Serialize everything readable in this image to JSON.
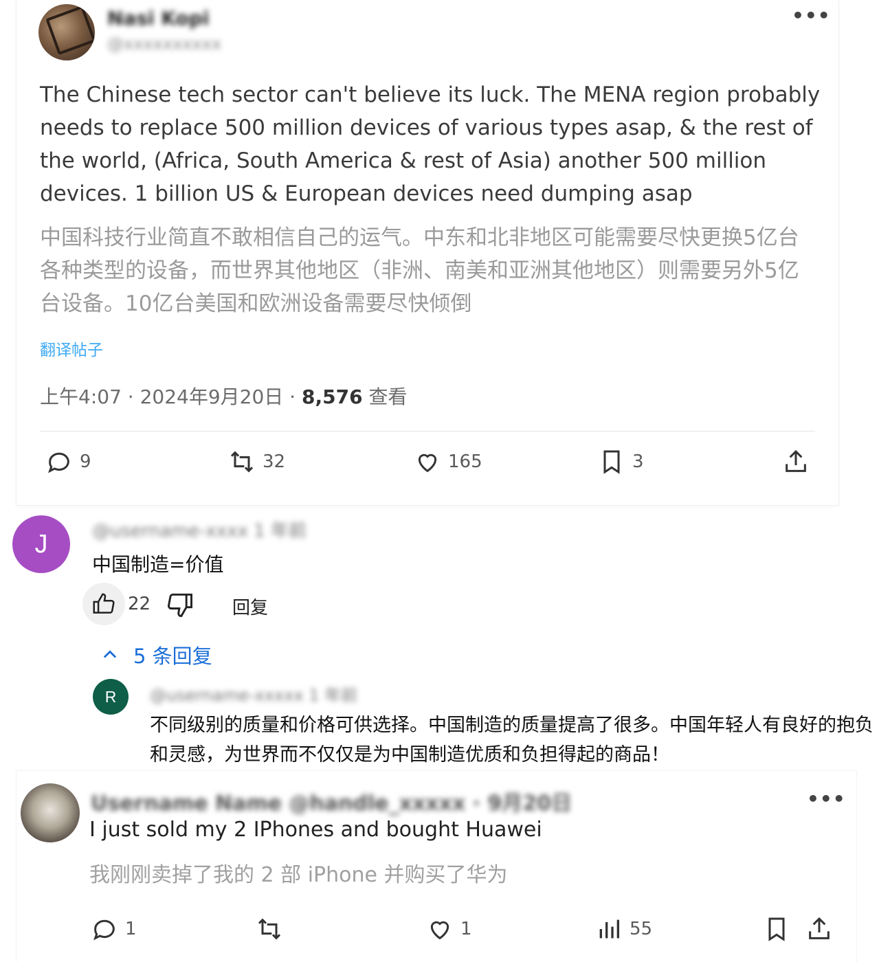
{
  "tweet": {
    "author_name": "Nasi Kopi",
    "author_handle": "@xxxxxxxxxx",
    "more": "•••",
    "text": "The Chinese tech sector can't believe its luck. The MENA region probably needs to replace 500 million devices of various types asap, & the rest of the world, (Africa, South America & rest of Asia) another 500 million devices. 1 billion US & European devices need dumping asap",
    "translation": "中国科技行业简直不敢相信自己的运气。中东和北非地区可能需要尽快更换5亿台各种类型的设备，而世界其他地区（非洲、南美和亚洲其他地区）则需要另外5亿台设备。10亿台美国和欧洲设备需要尽快倾倒",
    "translate_link": "翻译帖子",
    "time": "上午4:07 · 2024年9月20日 · ",
    "views_count": "8,576",
    "views_label": " 查看",
    "actions": {
      "replies": "9",
      "retweets": "32",
      "likes": "165",
      "bookmarks": "3"
    }
  },
  "comment_j": {
    "avatar_letter": "J",
    "author": "@username-xxxx 1 年前",
    "text": "中国制造=价值",
    "likes": "22",
    "reply_label": "回复",
    "replies_toggle": "5 条回复"
  },
  "reply_r": {
    "avatar_letter": "R",
    "author": "@username-xxxxx 1 年前",
    "text": "不同级别的质量和价格可供选择。中国制造的质量提高了很多。中国年轻人有良好的抱负和灵感，为世界而不仅仅是为中国制造优质和负担得起的商品！"
  },
  "bottom_tweet": {
    "author": "Username Name @handle_xxxxx · 9月20日",
    "more": "•••",
    "text": "I just sold my 2 IPhones and bought Huawei",
    "translation": "我刚刚卖掉了我的 2 部 iPhone 并购买了华为",
    "actions": {
      "replies": "1",
      "likes": "1",
      "views": "55"
    }
  },
  "colors": {
    "accent_blue": "#1d9bf0",
    "reply_blue": "#1a6ed8",
    "avatar_j": "#a64dc4",
    "avatar_r": "#0f5e47"
  }
}
